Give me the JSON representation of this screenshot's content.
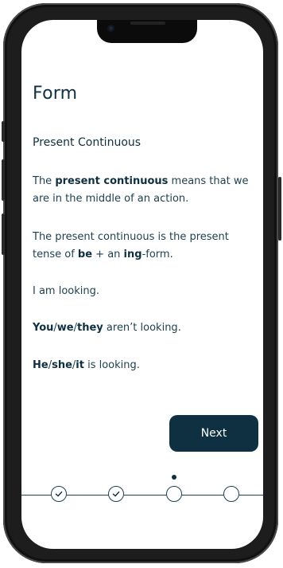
{
  "lesson": {
    "title": "Form",
    "subtitle": "Present Continuous",
    "p1": {
      "a": "The ",
      "b": "present continuous",
      "c": " means that we are in the middle of an action."
    },
    "p2": {
      "a": "The present continuous is the present tense of ",
      "b": "be",
      "c": " + an ",
      "d": "ing",
      "e": "-form."
    },
    "p3": "I am looking.",
    "p4": {
      "a": "You",
      "s1": "/",
      "b": "we",
      "s2": "/",
      "c": "they",
      "d": " aren’t looking."
    },
    "p5": {
      "a": "He",
      "s1": "/",
      "b": "she",
      "s2": "/",
      "c": "it",
      "d": " is looking."
    }
  },
  "actions": {
    "next_label": "Next"
  },
  "progress": {
    "steps": [
      {
        "state": "completed",
        "icon": "check-icon"
      },
      {
        "state": "completed",
        "icon": "check-icon"
      },
      {
        "state": "current",
        "icon": ""
      },
      {
        "state": "upcoming",
        "icon": ""
      }
    ],
    "current_index": 2
  },
  "colors": {
    "primary": "#0e3040",
    "text": "#1d3f4f",
    "background": "#ffffff"
  }
}
